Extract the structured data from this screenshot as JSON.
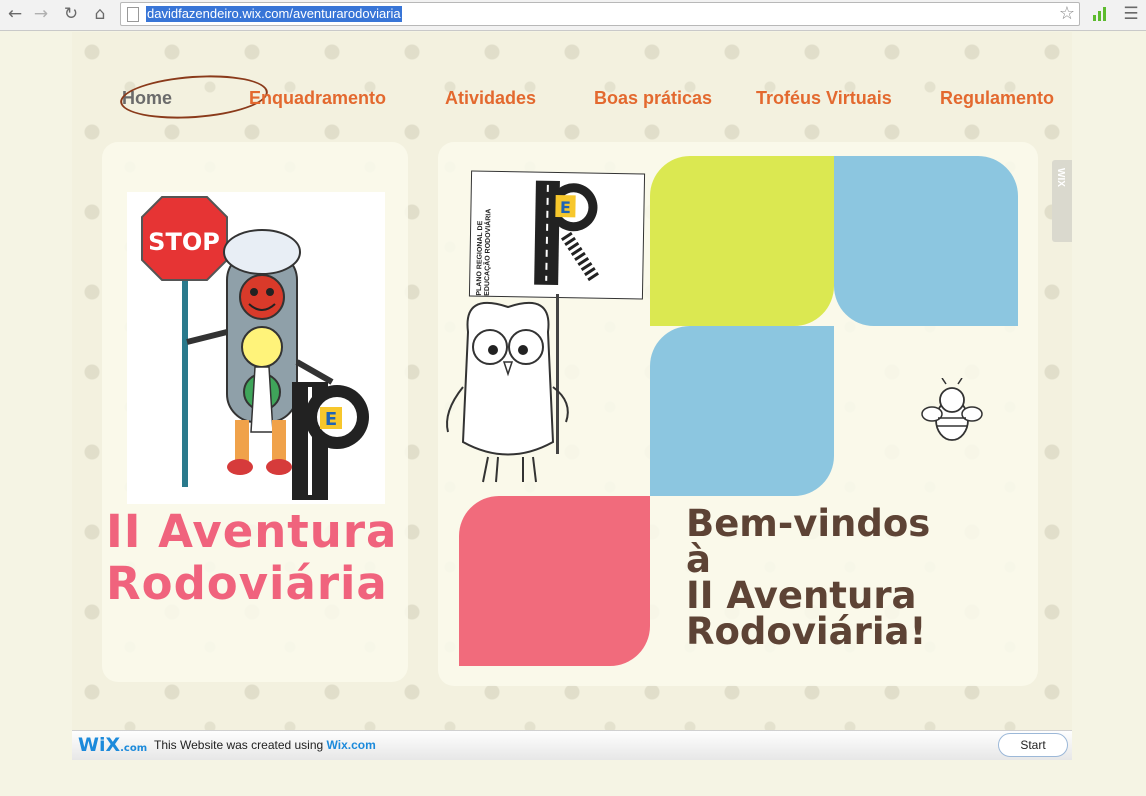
{
  "browser": {
    "url": "davidfazendeiro.wix.com/aventurarodoviaria"
  },
  "nav": {
    "items": [
      {
        "label": "Home",
        "active": true
      },
      {
        "label": "Enquadramento"
      },
      {
        "label": "Atividades"
      },
      {
        "label": "Boas práticas"
      },
      {
        "label": "Troféus Virtuais"
      },
      {
        "label": "Regulamento"
      }
    ]
  },
  "hero": {
    "title_line1": "II  Aventura",
    "title_line2": "Rodoviária",
    "stop_sign": "STOP",
    "sign_text": "PLANO REGIONAL DE EDUCAÇÃO RODOVIÁRIA",
    "sign_letter": "E"
  },
  "welcome": {
    "line1": "Bem-vindos",
    "line2": "à",
    "line3": "II Aventura",
    "line4": "Rodoviária!"
  },
  "side_tab": {
    "label": "WIX"
  },
  "wix_footer": {
    "logo": "WiX",
    "logo_suffix": ".com",
    "text": "This Website was created using",
    "link": "Wix.com",
    "start": "Start"
  },
  "colors": {
    "nav": "#e3692f",
    "pink": "#f0637d",
    "green": "#dbe851",
    "blue": "#8cc6e0",
    "brown": "#5d4335"
  }
}
